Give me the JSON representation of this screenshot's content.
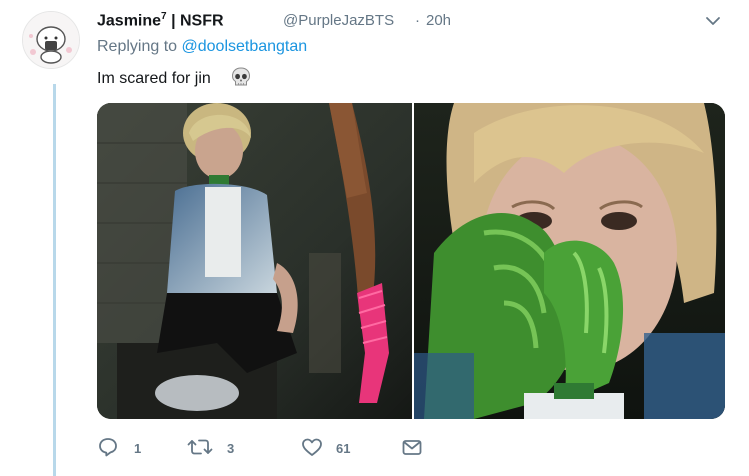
{
  "tweet": {
    "display_name": "Jasmine",
    "display_name_sup": "7",
    "badge": "| NSFR",
    "handle": "@PurpleJazBTS",
    "separator": "·",
    "time": "20h",
    "replying_prefix": "Replying to",
    "replying_to": "@doolsetbangtan",
    "text": "Im scared for jin",
    "emoji": "skull-emoji"
  },
  "actions": {
    "reply_count": "1",
    "retweet_count": "3",
    "like_count": "61"
  },
  "colors": {
    "link": "#1b95e0",
    "muted": "#657786",
    "thread_line": "#b8d8ea"
  },
  "icons": [
    "caret-down-icon",
    "reply-icon",
    "retweet-icon",
    "like-icon",
    "dm-icon",
    "skull-emoji"
  ]
}
